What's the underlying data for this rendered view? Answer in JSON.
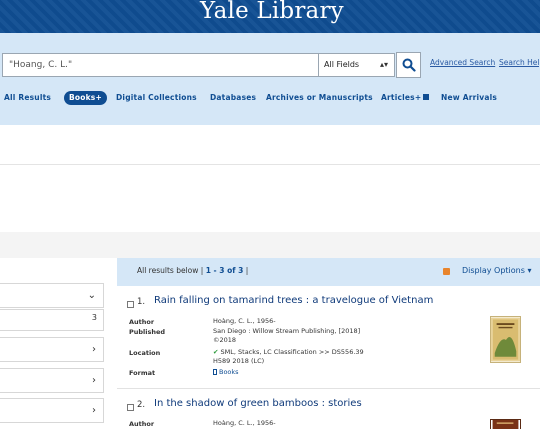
{
  "header": {
    "brand": "Yale Library"
  },
  "search": {
    "query": "\"Hoang, C. L.\"",
    "field": "All Fields",
    "advanced_label": "Advanced Search",
    "help_label": "Search Help"
  },
  "nav": {
    "items": [
      {
        "label": "All Results"
      },
      {
        "label": "Books+"
      },
      {
        "label": "Digital Collections"
      },
      {
        "label": "Databases"
      },
      {
        "label": "Archives or Manuscripts"
      },
      {
        "label": "Articles+"
      },
      {
        "label": "New Arrivals"
      }
    ],
    "active_index": 1
  },
  "facets": {
    "count_text": "3"
  },
  "results": {
    "summary_prefix": "All results below |",
    "range": "1 - 3 of 3",
    "summary_suffix": "|",
    "display_options": "Display Options ▾",
    "items": [
      {
        "number": "1.",
        "title": "Rain falling on tamarind trees : a travelogue of Vietnam",
        "author_label": "Author",
        "author": "Hoàng, C. L., 1956-",
        "published_label": "Published",
        "published_line1": "San Diego : Willow Stream Publishing, [2018]",
        "published_line2": "©2018",
        "location_label": "Location",
        "location_line1": "SML, Stacks, LC Classification >> DS556.39",
        "location_line2": "H589 2018 (LC)",
        "format_label": "Format",
        "format": "Books"
      },
      {
        "number": "2.",
        "title": "In the shadow of green bamboos : stories",
        "author_label": "Author",
        "author": "Hoàng, C. L., 1956-"
      }
    ]
  },
  "colors": {
    "brand_blue": "#0f4d92",
    "search_band": "#d5e7f7",
    "available_green": "#2b9a3a"
  }
}
